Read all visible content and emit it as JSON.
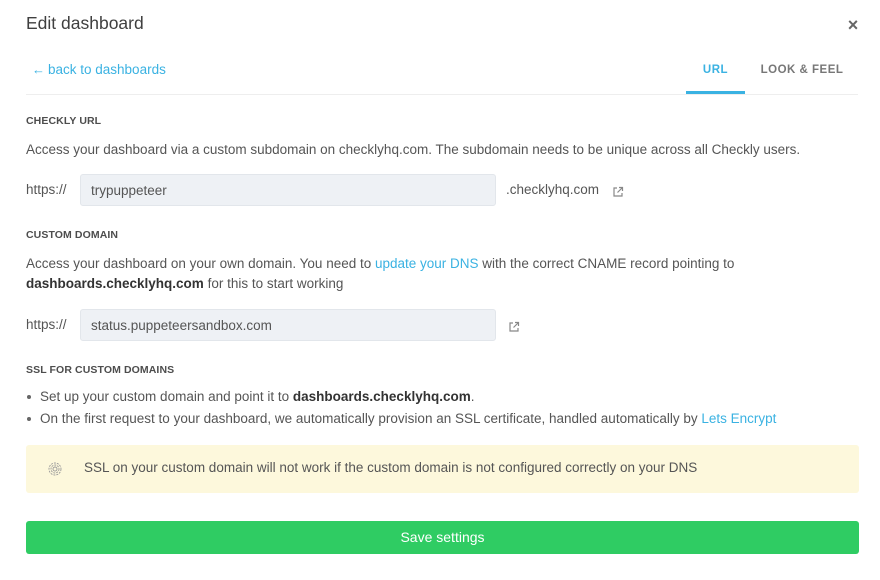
{
  "modal": {
    "title": "Edit dashboard",
    "close_symbol": "×"
  },
  "nav": {
    "back_arrow": "←",
    "back_label": "back to dashboards",
    "tabs": [
      {
        "label": "URL",
        "active": true
      },
      {
        "label": "LOOK & FEEL",
        "active": false
      }
    ]
  },
  "checkly_url": {
    "heading": "CHECKLY URL",
    "description": "Access your dashboard via a custom subdomain on checklyhq.com. The subdomain needs to be unique across all Checkly users.",
    "prefix": "https://",
    "value": "trypuppeteer",
    "suffix": ".checklyhq.com",
    "open_icon": "external-link-icon"
  },
  "custom_domain": {
    "heading": "CUSTOM DOMAIN",
    "desc_part1": "Access your dashboard on your own domain. You need to ",
    "desc_link": "update your DNS",
    "desc_part2": " with the correct CNAME record pointing to",
    "desc_bold": "dashboards.checklyhq.com",
    "desc_part3": " for this to start working",
    "prefix": "https://",
    "value": "status.puppeteersandbox.com",
    "open_icon": "external-link-icon"
  },
  "ssl": {
    "heading": "SSL FOR CUSTOM DOMAINS",
    "bullet1_text": "Set up your custom domain and point it to ",
    "bullet1_bold": "dashboards.checklyhq.com",
    "bullet1_end": ".",
    "bullet2_text": "On the first request to your dashboard, we automatically provision an SSL certificate, handled automatically by ",
    "bullet2_link": "Lets Encrypt"
  },
  "warning": {
    "icon": "fingerprint-icon",
    "text": "SSL on your custom domain will not work if the custom domain is not configured correctly on your DNS"
  },
  "actions": {
    "save_label": "Save settings"
  },
  "colors": {
    "accent": "#3ab2e2",
    "save_button": "#2fcc63",
    "warning_bg": "#fdf8dc",
    "input_bg": "#eef1f5"
  }
}
